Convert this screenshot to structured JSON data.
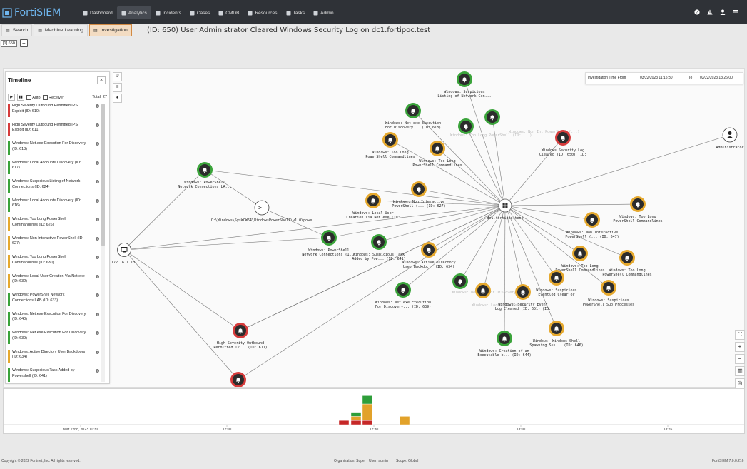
{
  "app": {
    "name": "FortiSIEM",
    "brand_color": "#6fb7f0"
  },
  "nav": [
    {
      "label": "Dashboard",
      "icon": "dashboard-icon"
    },
    {
      "label": "Analytics",
      "icon": "analytics-icon",
      "active": true
    },
    {
      "label": "Incidents",
      "icon": "bell-icon"
    },
    {
      "label": "Cases",
      "icon": "briefcase-icon"
    },
    {
      "label": "CMDB",
      "icon": "database-icon"
    },
    {
      "label": "Resources",
      "icon": "folder-icon"
    },
    {
      "label": "Tasks",
      "icon": "tasks-icon"
    },
    {
      "label": "Admin",
      "icon": "gear-icon"
    }
  ],
  "top_icons": [
    "help-icon",
    "alert-icon",
    "user-icon",
    "menu-icon"
  ],
  "subtabs": [
    {
      "label": "Search",
      "icon": "search-icon"
    },
    {
      "label": "Machine Learning",
      "icon": "ml-icon"
    },
    {
      "label": "Investigation",
      "icon": "investigation-icon",
      "active": true
    }
  ],
  "page_title": "(ID: 650) User Administrator Cleared Windows Security Log on dc1.fortipoc.test",
  "id_tab": "[1] 650",
  "timeline": {
    "title": "Timeline",
    "auto_label": "Auto",
    "receiver_label": "Receiver",
    "total_label": "Total: 27",
    "items": [
      {
        "text": "High Severity Outbound Permitted IPS Exploit (ID: 610)",
        "color": "#d63b3b"
      },
      {
        "text": "High Severity Outbound Permitted IPS Exploit (ID: 611)",
        "color": "#d63b3b"
      },
      {
        "text": "Windows: Net.exe Execution For Discovery (ID: 618)",
        "color": "#3aa33a"
      },
      {
        "text": "Windows: Local Accounts Discovery (ID: 617)",
        "color": "#3aa33a"
      },
      {
        "text": "Windows: Suspicious Listing of Network Connections (ID: 624)",
        "color": "#3aa33a"
      },
      {
        "text": "Windows: Local Accounts Discovery (ID: 616)",
        "color": "#3aa33a"
      },
      {
        "text": "Windows: Too Long PowerShell Commandlines (ID: 626)",
        "color": "#e6a92e"
      },
      {
        "text": "Windows: Non Interactive PowerShell (ID: 627)",
        "color": "#e6a92e"
      },
      {
        "text": "Windows: Too Long PowerShell Commandlines (ID: 630)",
        "color": "#e6a92e"
      },
      {
        "text": "Windows: Local User Creation Via Net.exe (ID: 632)",
        "color": "#e6a92e"
      },
      {
        "text": "Windows: PowerShell Network Connections LAB (ID: 633)",
        "color": "#3aa33a"
      },
      {
        "text": "Windows: Net.exe Execution For Discovery (ID: 640)",
        "color": "#3aa33a"
      },
      {
        "text": "Windows: Net.exe Execution For Discovery (ID: 639)",
        "color": "#3aa33a"
      },
      {
        "text": "Windows: Active Directory User Backdoors (ID: 634)",
        "color": "#e6a92e"
      },
      {
        "text": "Windows: Suspicious Task Added by Powershell (ID: 641)",
        "color": "#3aa33a"
      }
    ]
  },
  "investigation_time": {
    "from_label": "Investigation Time From",
    "from_value": "03/22/2023 11:15:30",
    "to_label": "To",
    "to_value": "03/22/2023 13:26:00"
  },
  "graph": {
    "hub_label": "dc1.fortipoc.test",
    "admin_label": "Administrator",
    "ip_label": "172.16.1.13",
    "cmd_label": "C:\\Windows\\SysWOW64\\WindowsPowerShell\\v1.0\\powe...",
    "nodes": [
      {
        "label": "Windows: Suspicious Listing of Network Con... (ID: 624)",
        "color": "#3aa33a"
      },
      {
        "label": "Windows: Net.exe Execution For Discovery... (ID: 618)",
        "color": "#3aa33a"
      },
      {
        "label": "Windows: Too Long PowerShell Commandlines (I... (ID: 626))",
        "color": "#e6a92e"
      },
      {
        "label": "Windows: Too Long PowerShell Commandlines (I... (ID: 630))",
        "color": "#e6a92e"
      },
      {
        "label": "Windows Security Log Cleared (ID: 650) (ID: 650)",
        "color": "#d63b3b"
      },
      {
        "label": "Windows: PowerShell Network Connections LA... (ID: 633)",
        "color": "#3aa33a"
      },
      {
        "label": "Windows: Non Interactive PowerShell (... (ID: 627)",
        "color": "#e6a92e"
      },
      {
        "label": "Windows: Local User Creation Via Net.exe (ID: 632)",
        "color": "#e6a92e"
      },
      {
        "label": "Windows: Too Long PowerShell Commandlines (I... (ID: 648)",
        "color": "#e6a92e"
      },
      {
        "label": "Windows: Non Interactive PowerShell (... (ID: 647)",
        "color": "#e6a92e"
      },
      {
        "label": "Windows: PowerShell Network Connections (I... (ID: 633)",
        "color": "#3aa33a"
      },
      {
        "label": "Windows: Suspicious Task Added by Pow... (ID: 641)",
        "color": "#3aa33a"
      },
      {
        "label": "Windows: Active Directory User Backdo... (ID: 634)",
        "color": "#e6a92e"
      },
      {
        "label": "Windows: Too Long PowerShell Commandlines (I... (ID: 649)",
        "color": "#e6a92e"
      },
      {
        "label": "Windows: Too Long PowerShell Commandlines (I... (ID: 670)",
        "color": "#e6a92e"
      },
      {
        "label": "Windows: Suspicious Eventlog Clear or Config... (ID: 669)",
        "color": "#e6a92e"
      },
      {
        "label": "Windows: Suspicious PowerShell Sub Processes (I... (ID: 667)",
        "color": "#e6a92e"
      },
      {
        "label": "Windows: Net.exe Execution For Discovery... (ID: 639)",
        "color": "#3aa33a"
      },
      {
        "label": "Windows: Security Event Log Cleared (ID: 651) (ID: 651)",
        "color": "#e6a92e"
      },
      {
        "label": "Windows: Windows Shell Spawning Sus... (ID: 646)",
        "color": "#e6a92e"
      },
      {
        "label": "High Severity Outbound Permitted IP... (ID: 611)",
        "color": "#d63b3b"
      },
      {
        "label": "Windows: Creation of an Executable b... (ID: 644)",
        "color": "#3aa33a"
      }
    ]
  },
  "histogram": {
    "ticks": [
      "Mar 22nd, 2023 11:30",
      "12:00",
      "12:30",
      "13:00",
      "13:26"
    ],
    "bars": [
      {
        "red": 1,
        "orange": 0,
        "green": 0
      },
      {
        "red": 1,
        "orange": 1,
        "green": 1
      },
      {
        "red": 1,
        "orange": 4,
        "green": 2
      },
      {
        "red": 0,
        "orange": 0,
        "green": 0
      },
      {
        "red": 0,
        "orange": 2,
        "green": 0
      }
    ]
  },
  "footer": {
    "copyright": "Copyright © 2022 Fortinet, Inc. All rights reserved.",
    "org": "Organization: Super",
    "user": "User: admin",
    "scope": "Scope: Global",
    "version": "FortiSIEM 7.0.0.216"
  }
}
